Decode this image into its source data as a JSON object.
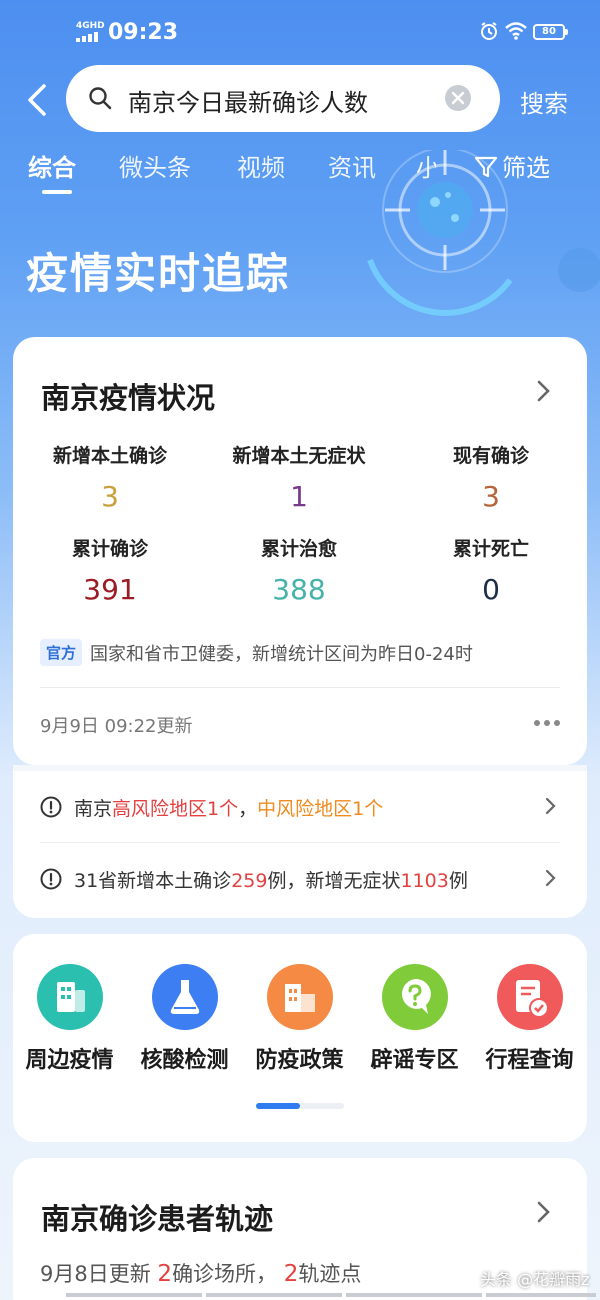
{
  "status_bar": {
    "network": "4GHD",
    "time": "09:23",
    "battery": "80"
  },
  "search": {
    "query": "南京今日最新确诊人数",
    "button": "搜索"
  },
  "tabs": [
    "综合",
    "微头条",
    "视频",
    "资讯",
    "小"
  ],
  "filter_label": "筛选",
  "banner_title": "疫情实时追踪",
  "status_card": {
    "title": "南京疫情状况",
    "stats": [
      {
        "label": "新增本土确诊",
        "value": "3",
        "color": "#c9a03c"
      },
      {
        "label": "新增本土无症状",
        "value": "1",
        "color": "#7a3a8c"
      },
      {
        "label": "现有确诊",
        "value": "3",
        "color": "#b5653a"
      },
      {
        "label": "累计确诊",
        "value": "391",
        "color": "#9b1c24"
      },
      {
        "label": "累计治愈",
        "value": "388",
        "color": "#46b3a8"
      },
      {
        "label": "累计死亡",
        "value": "0",
        "color": "#1e2f46"
      }
    ],
    "badge": "官方",
    "note": "国家和省市卫健委，新增统计区间为昨日0-24时",
    "updated": "9月9日 09:22更新"
  },
  "risk": {
    "row1": {
      "prefix": "南京",
      "high": "高风险地区1个",
      "sep": "，",
      "mid": "中风险地区1个"
    },
    "row2": {
      "a": "31省新增本土确诊",
      "n1": "259",
      "b": "例，新增无症状",
      "n2": "1103",
      "c": "例"
    }
  },
  "tools": [
    {
      "label": "周边疫情",
      "icon": "building-icon",
      "color": "#2bbfb0"
    },
    {
      "label": "核酸检测",
      "icon": "flask-icon",
      "color": "#3d7ef2"
    },
    {
      "label": "防疫政策",
      "icon": "city-icon",
      "color": "#f58a44"
    },
    {
      "label": "辟谣专区",
      "icon": "question-bubble-icon",
      "color": "#7fcb3a"
    },
    {
      "label": "行程查询",
      "icon": "document-check-icon",
      "color": "#f05a5a"
    }
  ],
  "track_card": {
    "title": "南京确诊患者轨迹",
    "sub_a": "9月8日更新",
    "n1": "2",
    "sub_b": "确诊场所，",
    "n2": "2",
    "sub_c": "轨迹点"
  },
  "watermark": "头条 @花瓣雨z"
}
